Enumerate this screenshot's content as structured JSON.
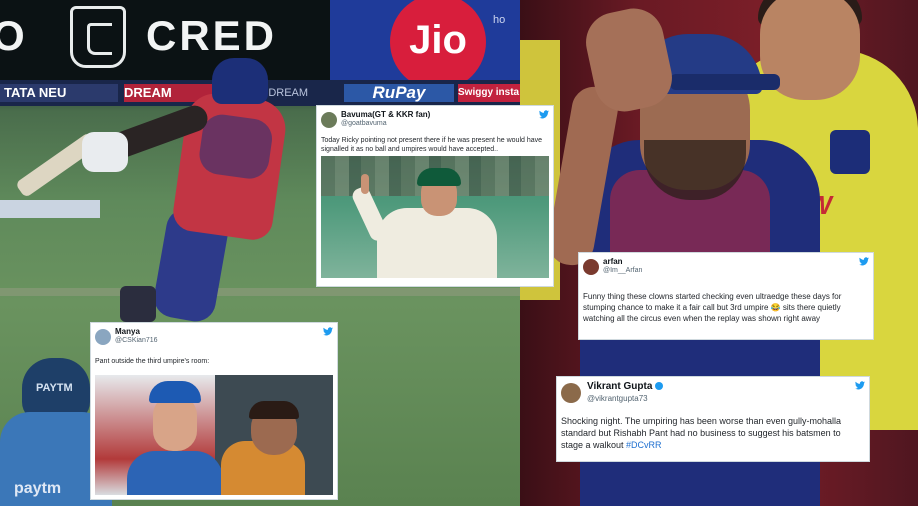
{
  "background": {
    "left_photo": {
      "hoarding": {
        "cred_text": "CRED",
        "cred_partial": "O",
        "jio_text": "Jio",
        "jio_side": "ho"
      },
      "sponsors": {
        "tata": "TATA NEU",
        "dream": "DREAM",
        "mid": "ED  DREAM",
        "rupay": "RuPay",
        "swiggy": "Swiggy insta"
      },
      "fielder_text": "paytm",
      "fielder_cap_text": "PAYTM"
    },
    "right_photo": {
      "yellow_text": "SW"
    }
  },
  "tweets": {
    "bavuma": {
      "name": "Bavuma(GT & KKR fan)",
      "handle": "@goatbavuma",
      "text": "Today Ricky pointing not present  there if he was present he would have signalled it as no ball and umpires would have accepted..",
      "image_alt": "Ricky Ponting raising finger"
    },
    "manya": {
      "name": "Manya",
      "handle": "@CSKian716",
      "text": "Pant outside the third umpire's room:",
      "image_alt": "Ponting and Pant"
    },
    "arfan": {
      "name": "arfan",
      "handle": "@Im__Arfan",
      "text": "Funny thing these clowns started checking even ultraedge these days for stumping chance to make it a fair call but 3rd umpire 😂 sits there quietly watching all the circus even when the replay was shown right away"
    },
    "vikrant": {
      "name": "Vikrant Gupta",
      "handle": "@vikrantgupta73",
      "text_main": "Shocking night. The umpiring has been worse than even gully-mohalla standard but Rishabh Pant had no business to suggest his batsmen to stage a walkout ",
      "hashtag": "#DCvRR"
    }
  },
  "colors": {
    "twitter_blue": "#1d9bf0",
    "dc_red": "#c23544",
    "dc_blue": "#2d3a8a"
  }
}
